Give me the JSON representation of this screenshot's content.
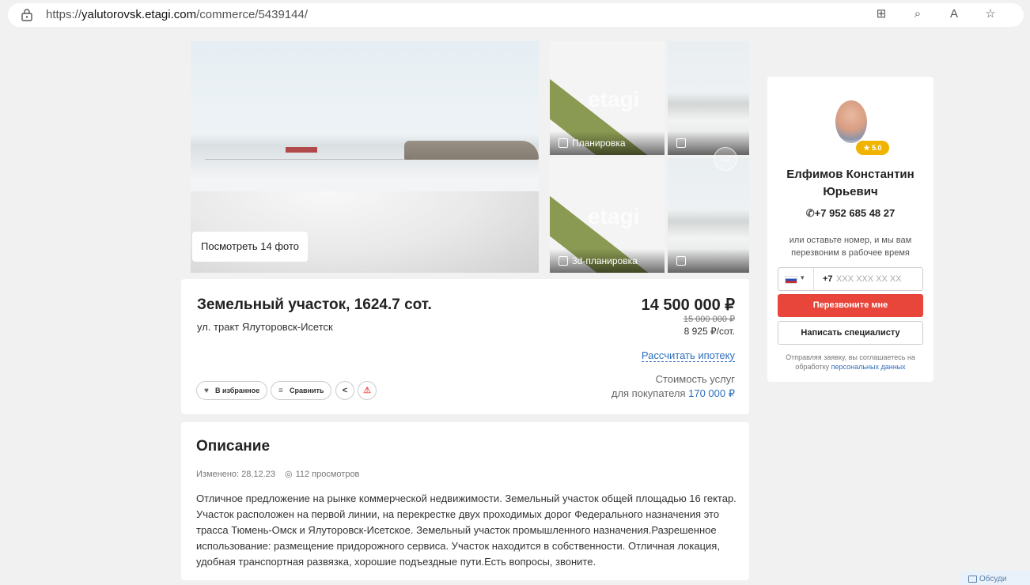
{
  "browser": {
    "url_prefix": "https://",
    "url_domain": "yalutorovsk.etagi.com",
    "url_path": "/commerce/5439144/"
  },
  "gallery": {
    "view_photos_label": "Посмотреть 14 фото",
    "thumb_plan_label": "Планировка",
    "thumb_3d_label": "3d-планировка",
    "watermark": "etagi"
  },
  "listing": {
    "title": "Земельный участок, 1624.7 сот.",
    "address": "ул. тракт Ялуторовск-Исетск",
    "price": "14 500 000 ₽",
    "old_price": "15 000 000 ₽",
    "price_per_unit": "8 925 ₽/сот.",
    "mortgage_link": "Рассчитать ипотеку",
    "services_line1": "Стоимость услуг",
    "services_line2_prefix": "для покупателя ",
    "services_amount": "170 000 ₽",
    "favorite_label": "В избранное",
    "compare_label": "Сравнить"
  },
  "description": {
    "heading": "Описание",
    "changed": "Изменено: 28.12.23",
    "views": "112 просмотров",
    "text": "Отличное предложение на рынке коммерческой недвижимости. Земельный участок общей площадью 16 гектар. Участок расположен на первой линии, на перекрестке двух проходимых дорог Федерального назначения это трасса Тюмень-Омск и Ялуторовск-Исетское. Земельный участок промышленного назначения.Разрешенное использование: размещение придорожного сервиса. Участок находится в собственности. Отличная локация, удобная транспортная развязка, хорошие подъездные пути.Есть вопросы, звоните."
  },
  "agent": {
    "rating": "5.0",
    "name": "Елфимов Константин Юрьевич",
    "phone": "+7 952 685 48 27",
    "callback_hint": "или оставьте номер, и мы вам перезвоним в рабочее время",
    "country_code": "+7",
    "phone_placeholder": "XXX XXX XX XX",
    "call_me_label": "Перезвоните мне",
    "write_label": "Написать специалисту",
    "consent_prefix": "Отправляя заявку, вы соглашаетесь на обработку ",
    "consent_link": "персональных данных"
  },
  "chat": {
    "label": "Обсуди"
  },
  "colors": {
    "accent_red": "#e8463b",
    "link_blue": "#2f6fbd",
    "rating_gold": "#f0b400"
  }
}
